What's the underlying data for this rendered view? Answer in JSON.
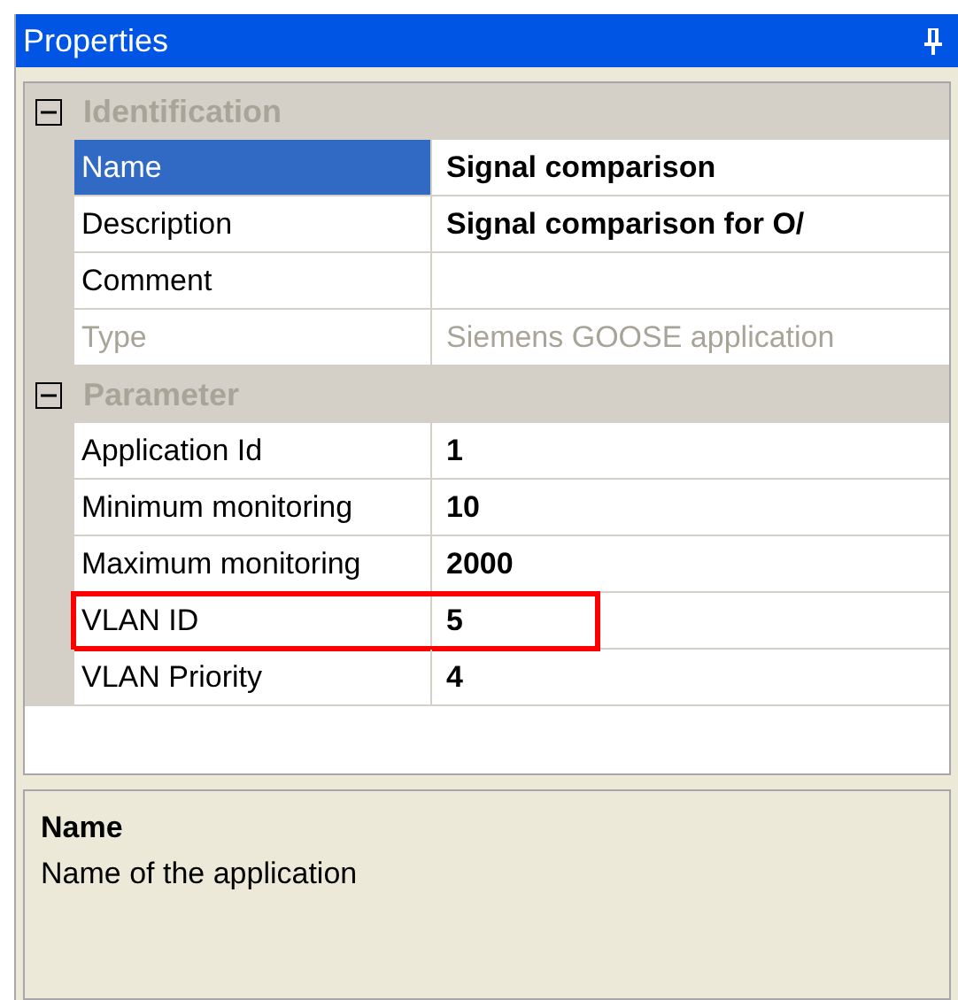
{
  "window": {
    "title": "Properties"
  },
  "categories": [
    {
      "label": "Identification",
      "expanded": true,
      "rows": [
        {
          "kind": "plain",
          "label": "Name",
          "value": "Signal comparison",
          "selected": true,
          "disabled": false
        },
        {
          "kind": "plain",
          "label": "Description",
          "value": "Signal comparison for O/",
          "selected": false,
          "disabled": false
        },
        {
          "kind": "plain",
          "label": "Comment",
          "selected": false,
          "disabled": false
        },
        {
          "kind": "plain",
          "label": "Type",
          "value": "Siemens GOOSE application",
          "selected": false,
          "disabled": true
        }
      ]
    },
    {
      "label": "Parameter",
      "expanded": true,
      "rows": [
        {
          "kind": "plain",
          "label": "Application Id",
          "value": "1",
          "selected": false,
          "disabled": false
        },
        {
          "kind": "plain",
          "label": "Minimum monitoring",
          "value": "10",
          "selected": false,
          "disabled": false
        },
        {
          "kind": "plain",
          "label": "Maximum monitoring",
          "value": "2000",
          "selected": false,
          "disabled": false
        },
        {
          "kind": "framed",
          "label": "VLAN ID",
          "value": "5",
          "selected": false,
          "disabled": false
        },
        {
          "kind": "plain",
          "label": "VLAN Priority",
          "value": "4",
          "selected": false,
          "disabled": false
        }
      ]
    }
  ],
  "help": {
    "title": "Name",
    "text": "Name of the application"
  }
}
